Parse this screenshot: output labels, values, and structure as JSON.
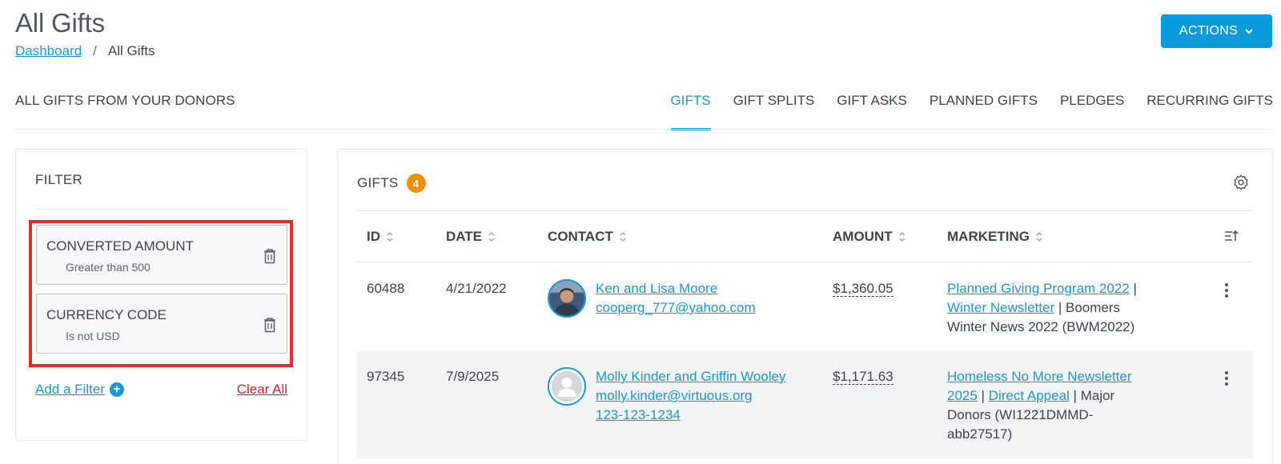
{
  "header": {
    "title": "All Gifts",
    "breadcrumb": {
      "link": "Dashboard",
      "separator": "/",
      "current": "All Gifts"
    },
    "actions_label": "ACTIONS"
  },
  "subheading": "ALL GIFTS FROM YOUR DONORS",
  "tabs": [
    {
      "label": "GIFTS",
      "active": true
    },
    {
      "label": "GIFT SPLITS"
    },
    {
      "label": "GIFT ASKS"
    },
    {
      "label": "PLANNED GIFTS"
    },
    {
      "label": "PLEDGES"
    },
    {
      "label": "RECURRING GIFTS"
    }
  ],
  "filter": {
    "title": "FILTER",
    "items": [
      {
        "title": "CONVERTED AMOUNT",
        "condition": "Greater than 500"
      },
      {
        "title": "CURRENCY CODE",
        "condition": "Is not USD"
      }
    ],
    "add_label": "Add a Filter",
    "clear_label": "Clear All"
  },
  "gifts": {
    "title": "GIFTS",
    "count": "4",
    "columns": [
      "ID",
      "DATE",
      "CONTACT",
      "AMOUNT",
      "MARKETING"
    ],
    "rows": [
      {
        "id": "60488",
        "date": "4/21/2022",
        "contact_name": "Ken and Lisa Moore",
        "contact_email": "cooperg_777@yahoo.com",
        "contact_phone": "",
        "amount": "$1,360.05",
        "marketing_link1": "Planned Giving Program 2022",
        "marketing_link2": "Winter Newsletter",
        "marketing_text": "Boomers Winter News 2022 (BWM2022)"
      },
      {
        "id": "97345",
        "date": "7/9/2025",
        "contact_name": "Molly Kinder and Griffin Wooley",
        "contact_email": "molly.kinder@virtuous.org",
        "contact_phone": "123-123-1234",
        "amount": "$1,171.63",
        "marketing_link1": "Homeless No More Newsletter 2025",
        "marketing_link2": "Direct Appeal",
        "marketing_text": "Major Donors (WI1221DMMD-abb27517)"
      }
    ]
  },
  "colors": {
    "accent": "#1a98d5",
    "button": "#0a9ade",
    "badge": "#ee8f10",
    "highlight": "#e82a2a",
    "danger": "#e21d25"
  },
  "icons": {
    "actions_chevron": "chevron-down-icon",
    "trash": "trash-icon",
    "settings": "gear-icon",
    "sort": "sort-icon",
    "columns": "column-sort-icon",
    "kebab": "kebab-menu-icon",
    "add": "plus-circle-icon"
  }
}
